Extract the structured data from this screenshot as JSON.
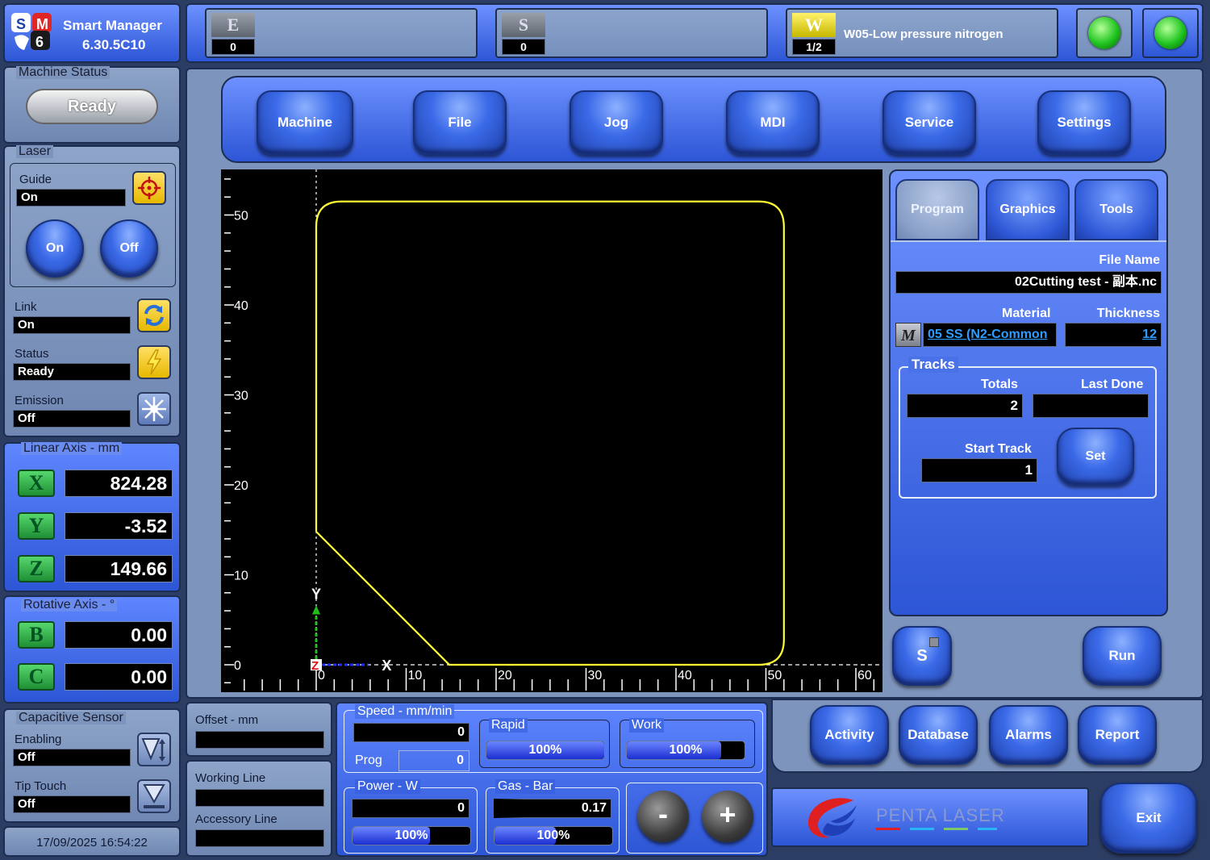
{
  "app": {
    "name": "Smart Manager",
    "version": "6.30.5C10",
    "logo_letters": [
      "S",
      "M",
      "6"
    ]
  },
  "top_status": {
    "e": {
      "letter": "E",
      "count": "0",
      "message": ""
    },
    "s": {
      "letter": "S",
      "count": "0",
      "message": ""
    },
    "w": {
      "letter": "W",
      "count": "1/2",
      "message": "W05-Low pressure nitrogen"
    },
    "led_colors": [
      "#1fc41f",
      "#1fc41f"
    ]
  },
  "machine_status": {
    "caption": "Machine Status",
    "state": "Ready"
  },
  "laser": {
    "caption": "Laser",
    "guide_label": "Guide",
    "guide_value": "On",
    "on_label": "On",
    "off_label": "Off",
    "link_label": "Link",
    "link_value": "On",
    "status_label": "Status",
    "status_value": "Ready",
    "emission_label": "Emission",
    "emission_value": "Off"
  },
  "linear_axis": {
    "caption": "Linear Axis - mm",
    "axes": [
      {
        "name": "X",
        "value": "824.28"
      },
      {
        "name": "Y",
        "value": "-3.52"
      },
      {
        "name": "Z",
        "value": "149.66"
      }
    ]
  },
  "rotative_axis": {
    "caption": "Rotative Axis - °",
    "axes": [
      {
        "name": "B",
        "value": "0.00"
      },
      {
        "name": "C",
        "value": "0.00"
      }
    ]
  },
  "capacitive_sensor": {
    "caption": "Capacitive Sensor",
    "enabling_label": "Enabling",
    "enabling_value": "Off",
    "tip_touch_label": "Tip Touch",
    "tip_touch_value": "Off"
  },
  "datetime": "17/09/2025 16:54:22",
  "nav": [
    "Machine",
    "File",
    "Jog",
    "MDI",
    "Service",
    "Settings"
  ],
  "graphics": {
    "x_ticks": [
      "0",
      "10",
      "20",
      "30",
      "40",
      "50",
      "60"
    ],
    "y_ticks": [
      "0",
      "10",
      "20",
      "30",
      "40",
      "50"
    ],
    "x_axis_label": "X",
    "y_axis_label": "Y",
    "z_axis_label": "Z",
    "path_color": "#ffff33"
  },
  "right_panel": {
    "tabs": [
      "Program",
      "Graphics",
      "Tools"
    ],
    "file_name_label": "File Name",
    "file_name": "02Cutting test - 副本.nc",
    "material_label": "Material",
    "material": "05 SS (N2-Common",
    "material_icon_text": "M",
    "thickness_label": "Thickness",
    "thickness": "12",
    "tracks": {
      "caption": "Tracks",
      "totals_label": "Totals",
      "totals": "2",
      "last_done_label": "Last Done",
      "last_done": "",
      "start_track_label": "Start Track",
      "start_track": "1",
      "set_label": "Set"
    },
    "s_button": "S",
    "run_label": "Run"
  },
  "offset": {
    "caption": "Offset - mm",
    "value": "",
    "working_line_label": "Working Line",
    "working_line": "",
    "accessory_line_label": "Accessory Line",
    "accessory_line": ""
  },
  "speed": {
    "caption": "Speed - mm/min",
    "value": "0",
    "prog_label": "Prog",
    "prog_value": "0",
    "rapid_caption": "Rapid",
    "rapid": "100%",
    "rapid_fraction": 1.0,
    "work_caption": "Work",
    "work": "100%",
    "work_fraction": 0.8
  },
  "power": {
    "caption": "Power - W",
    "value": "0",
    "pct": "100%",
    "fraction": 0.66
  },
  "gas": {
    "caption": "Gas - Bar",
    "value": "0.17",
    "pct": "100%",
    "fraction": 0.52
  },
  "minus_label": "-",
  "plus_label": "+",
  "bottom_buttons": [
    "Activity",
    "Database",
    "Alarms",
    "Report"
  ],
  "brand": "PENTA LASER",
  "exit_label": "Exit"
}
